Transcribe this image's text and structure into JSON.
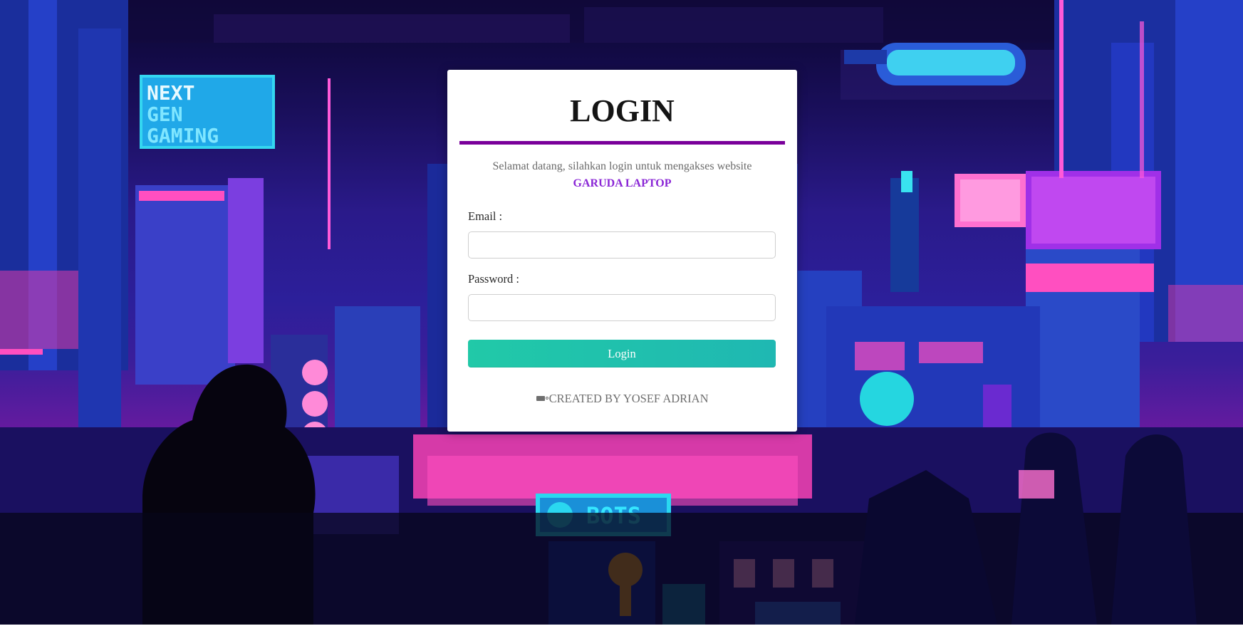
{
  "login_card": {
    "title": "LOGIN",
    "welcome_text": "Selamat datang, silahkan login untuk mengakses website",
    "brand_name": "GARUDA LAPTOP",
    "email_label": "Email :",
    "email_value": "",
    "password_label": "Password :",
    "password_value": "",
    "login_button_label": "Login",
    "credit_text": "CREATED BY YOSEF ADRIAN",
    "credit_icon": "plug-icon"
  },
  "background": {
    "description_icon": "pixel-cyberpunk-city-icon",
    "sign_texts": [
      "NEXT",
      "GEN",
      "GAMING",
      "BOTS"
    ]
  },
  "colors": {
    "title_bar": "#7a009a",
    "brand": "#8a26d6",
    "button": "#21c9a8"
  }
}
